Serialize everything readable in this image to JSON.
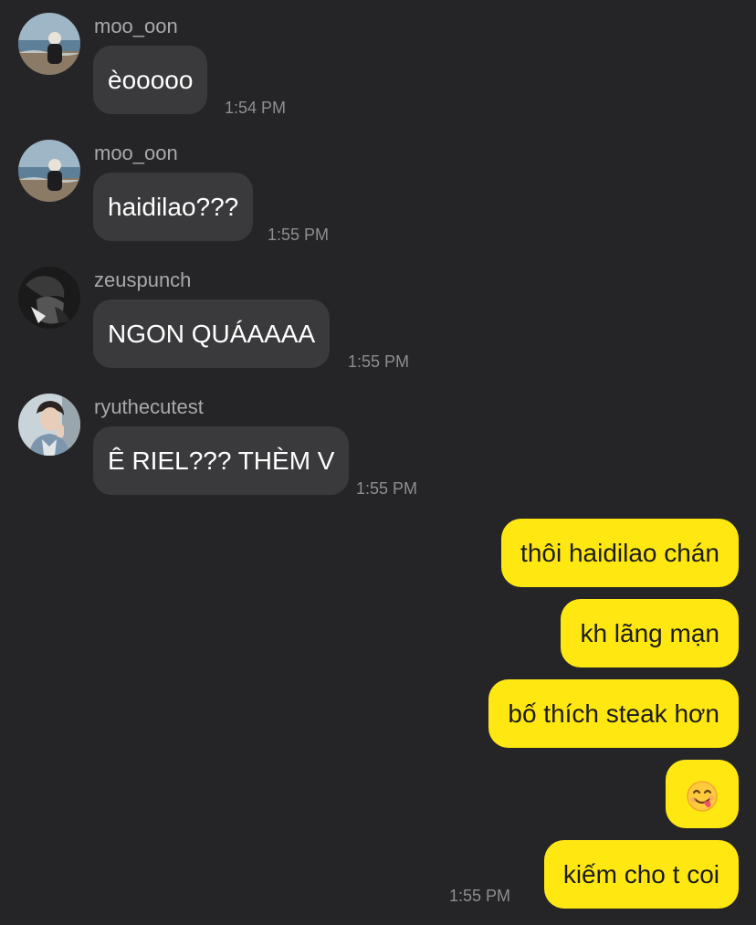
{
  "incoming": [
    {
      "sender": "moo_oon",
      "text": "èooooo",
      "time": "1:54 PM",
      "avatar": "sea-photo-avatar-icon"
    },
    {
      "sender": "moo_oon",
      "text": "haidilao???",
      "time": "1:55 PM",
      "avatar": "sea-photo-avatar-icon"
    },
    {
      "sender": "zeuspunch",
      "text": "NGON QUÁAAAA",
      "time": "1:55 PM",
      "avatar": "bw-photo-avatar-icon"
    },
    {
      "sender": "ryuthecutest",
      "text": "Ê RIEL??? THÈM V",
      "time": "1:55 PM",
      "avatar": "person-photo-avatar-icon"
    }
  ],
  "outgoing": [
    {
      "text": "thôi haidilao chán"
    },
    {
      "text": "kh lãng mạn"
    },
    {
      "text": "bố thích steak hơn"
    },
    {
      "text": "",
      "emoji": "yum-face-emoji-icon"
    },
    {
      "text": "kiếm cho t coi"
    }
  ],
  "outgoing_time": "1:55 PM",
  "colors": {
    "background": "#252527",
    "incoming_bubble": "#3a3a3c",
    "outgoing_bubble": "#ffe812",
    "sender_text": "#a9a9ad",
    "time_text": "#8e8e93"
  }
}
